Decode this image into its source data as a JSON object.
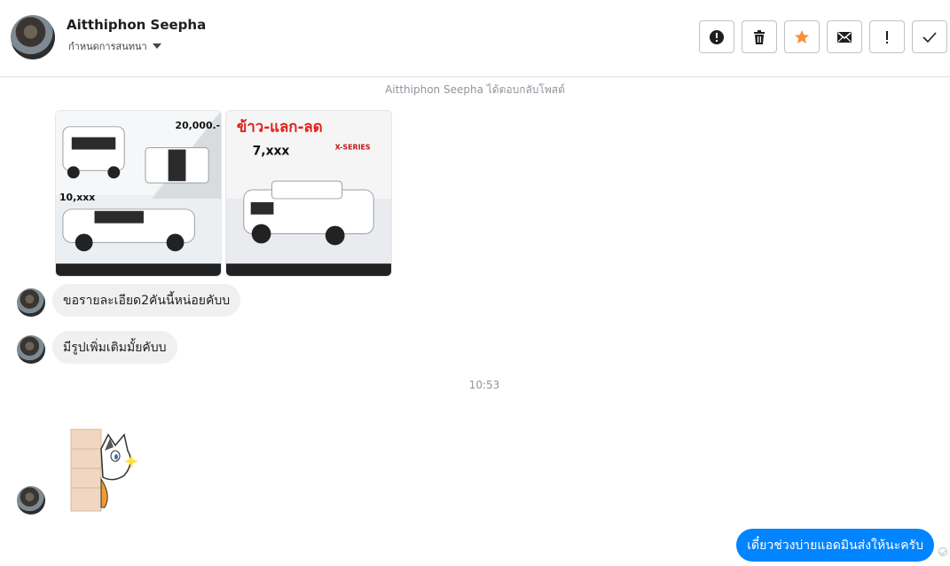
{
  "header": {
    "name": "Aitthiphon Seepha",
    "subtitle": "กำหนดการสนทนา"
  },
  "actions": [
    {
      "icon": "alert-circle-icon"
    },
    {
      "icon": "trash-icon"
    },
    {
      "icon": "star-icon",
      "color": "#f7923b"
    },
    {
      "icon": "mail-icon"
    },
    {
      "icon": "exclamation-icon"
    },
    {
      "icon": "check-icon"
    }
  ],
  "conversation": {
    "context_note": "Aitthiphon Seepha ได้ตอบกลับโพสต์",
    "images": [
      {
        "texts": [
          "20,000.-",
          "10,xxx"
        ]
      },
      {
        "texts": [
          "ข้าว-แลก-ลด",
          "7,xxx",
          "X-SERIES"
        ]
      }
    ],
    "messages_in": [
      {
        "text": "ขอรายละเอียด2คันนี้หน่อยคับบ"
      },
      {
        "text": "มีรูปเพิ่มเติมมั้ยคับบ"
      }
    ],
    "timestamp": "10:53",
    "sticker": "cat-peeking-sticker",
    "message_out": "เดี๋ยวช่วงบ่ายแอดมินส่งให้นะครับ"
  },
  "colors": {
    "outgoing_bubble": "#0084ff",
    "incoming_bubble": "#f1f0f0",
    "star": "#f7923b"
  }
}
